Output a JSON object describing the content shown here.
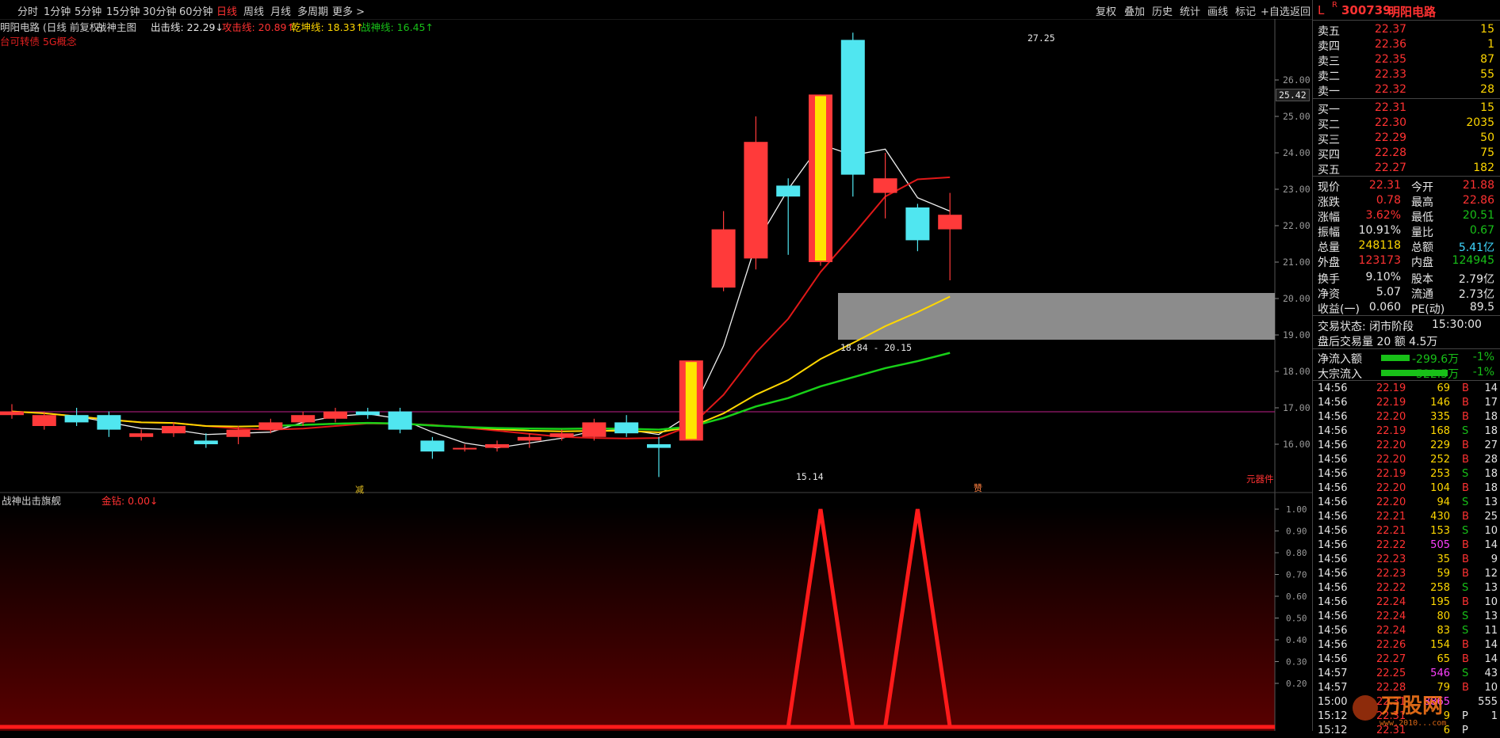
{
  "timeframes": {
    "items": [
      "分时",
      "1分钟",
      "5分钟",
      "15分钟",
      "30分钟",
      "60分钟",
      "日线",
      "周线",
      "月线",
      "多周期",
      "更多 >"
    ],
    "active": "日线"
  },
  "toolbar": {
    "items": [
      "复权",
      "叠加",
      "历史",
      "统计",
      "画线",
      "标记",
      "+自选",
      "返回"
    ]
  },
  "chart_header": {
    "stock": "明阳电路 (日线 前复权)",
    "indicator": "战神主图",
    "lines": [
      {
        "label": "出击线: 22.29↓",
        "color": "#e6e6e6"
      },
      {
        "label": "攻击线: 20.89↑",
        "color": "#ff3232"
      },
      {
        "label": "乾坤线: 18.33↑",
        "color": "#ffd700"
      },
      {
        "label": "战神线: 16.45↑",
        "color": "#18c018"
      }
    ],
    "concept": "台可转债 5G概念"
  },
  "price_axis": [
    "26.00",
    "25.00",
    "24.00",
    "23.00",
    "22.00",
    "21.00",
    "20.00",
    "19.00",
    "18.00",
    "17.00",
    "16.00"
  ],
  "price_tag": "25.42",
  "annotations": {
    "high": "27.25",
    "low": "15.14",
    "zone": "18.84 - 20.15",
    "mark_left": "减",
    "mark_right": "赞",
    "corner": "元器件"
  },
  "sub_chart": {
    "title": "战神出击旗舰",
    "value_label": "金钻: 0.00↓",
    "axis": [
      "1.00",
      "0.90",
      "0.80",
      "0.70",
      "0.60",
      "0.50",
      "0.40",
      "0.30",
      "0.20"
    ]
  },
  "chart_data": {
    "type": "candlestick",
    "candles": [
      {
        "o": 16.8,
        "c": 16.9,
        "h": 17.1,
        "l": 16.7
      },
      {
        "o": 16.5,
        "c": 16.8,
        "h": 16.9,
        "l": 16.4
      },
      {
        "o": 16.8,
        "c": 16.6,
        "h": 17.0,
        "l": 16.5
      },
      {
        "o": 16.8,
        "c": 16.4,
        "h": 16.9,
        "l": 16.2
      },
      {
        "o": 16.2,
        "c": 16.3,
        "h": 16.4,
        "l": 16.1
      },
      {
        "o": 16.3,
        "c": 16.5,
        "h": 16.6,
        "l": 16.2
      },
      {
        "o": 16.1,
        "c": 16.0,
        "h": 16.3,
        "l": 15.9
      },
      {
        "o": 16.2,
        "c": 16.4,
        "h": 16.5,
        "l": 16.0
      },
      {
        "o": 16.4,
        "c": 16.6,
        "h": 16.7,
        "l": 16.3
      },
      {
        "o": 16.6,
        "c": 16.8,
        "h": 16.9,
        "l": 16.5
      },
      {
        "o": 16.7,
        "c": 16.9,
        "h": 17.0,
        "l": 16.6
      },
      {
        "o": 16.9,
        "c": 16.8,
        "h": 17.0,
        "l": 16.7
      },
      {
        "o": 16.9,
        "c": 16.4,
        "h": 17.0,
        "l": 16.3
      },
      {
        "o": 16.1,
        "c": 15.8,
        "h": 16.2,
        "l": 15.6
      },
      {
        "o": 15.9,
        "c": 15.9,
        "h": 16.0,
        "l": 15.8
      },
      {
        "o": 15.9,
        "c": 16.0,
        "h": 16.1,
        "l": 15.8
      },
      {
        "o": 16.1,
        "c": 16.2,
        "h": 16.3,
        "l": 15.9
      },
      {
        "o": 16.2,
        "c": 16.3,
        "h": 16.4,
        "l": 16.1
      },
      {
        "o": 16.2,
        "c": 16.6,
        "h": 16.7,
        "l": 16.1
      },
      {
        "o": 16.6,
        "c": 16.3,
        "h": 16.8,
        "l": 16.2
      },
      {
        "o": 16.0,
        "c": 15.9,
        "h": 16.2,
        "l": 15.1
      },
      {
        "o": 16.1,
        "c": 18.3,
        "h": 18.3,
        "l": 16.1
      },
      {
        "o": 20.3,
        "c": 21.9,
        "h": 22.4,
        "l": 20.2
      },
      {
        "o": 21.1,
        "c": 24.3,
        "h": 25.0,
        "l": 20.8
      },
      {
        "o": 23.1,
        "c": 22.8,
        "h": 23.3,
        "l": 21.2
      },
      {
        "o": 21.0,
        "c": 25.6,
        "h": 25.6,
        "l": 20.9
      },
      {
        "o": 27.1,
        "c": 23.4,
        "h": 27.3,
        "l": 22.8
      },
      {
        "o": 22.9,
        "c": 23.3,
        "h": 24.0,
        "l": 22.2
      },
      {
        "o": 22.5,
        "c": 21.6,
        "h": 22.6,
        "l": 21.3
      },
      {
        "o": 21.9,
        "c": 22.3,
        "h": 22.9,
        "l": 20.5
      }
    ],
    "sub_values": [
      0,
      0,
      0,
      0,
      0,
      0,
      0,
      0,
      0,
      0,
      0,
      0,
      0,
      0,
      0,
      0,
      0,
      0,
      0,
      0,
      0,
      0,
      0,
      0,
      0,
      1,
      0,
      0,
      1,
      0
    ]
  },
  "quote": {
    "code": "300739",
    "name": "明阳电路",
    "prefix": "L",
    "sup": "R",
    "asks": [
      {
        "label": "卖五",
        "price": "22.37",
        "vol": "15"
      },
      {
        "label": "卖四",
        "price": "22.36",
        "vol": "1"
      },
      {
        "label": "卖三",
        "price": "22.35",
        "vol": "87"
      },
      {
        "label": "卖二",
        "price": "22.33",
        "vol": "55"
      },
      {
        "label": "卖一",
        "price": "22.32",
        "vol": "28"
      }
    ],
    "bids": [
      {
        "label": "买一",
        "price": "22.31",
        "vol": "15"
      },
      {
        "label": "买二",
        "price": "22.30",
        "vol": "2035"
      },
      {
        "label": "买三",
        "price": "22.29",
        "vol": "50"
      },
      {
        "label": "买四",
        "price": "22.28",
        "vol": "75"
      },
      {
        "label": "买五",
        "price": "22.27",
        "vol": "182"
      }
    ],
    "stats": [
      {
        "l1": "现价",
        "v1": "22.31",
        "c1": "red",
        "l2": "今开",
        "v2": "21.88",
        "c2": "red"
      },
      {
        "l1": "涨跌",
        "v1": "0.78",
        "c1": "red",
        "l2": "最高",
        "v2": "22.86",
        "c2": "red"
      },
      {
        "l1": "涨幅",
        "v1": "3.62%",
        "c1": "red",
        "l2": "最低",
        "v2": "20.51",
        "c2": "green"
      },
      {
        "l1": "振幅",
        "v1": "10.91%",
        "c1": "white",
        "l2": "量比",
        "v2": "0.67",
        "c2": "green"
      },
      {
        "l1": "总量",
        "v1": "248118",
        "c1": "yellow",
        "l2": "总额",
        "v2": "5.41亿",
        "c2": "cyan"
      },
      {
        "l1": "外盘",
        "v1": "123173",
        "c1": "red",
        "l2": "内盘",
        "v2": "124945",
        "c2": "green"
      },
      {
        "l1": "换手",
        "v1": "9.10%",
        "c1": "white",
        "l2": "股本",
        "v2": "2.79亿",
        "c2": "white"
      },
      {
        "l1": "净资",
        "v1": "5.07",
        "c1": "white",
        "l2": "流通",
        "v2": "2.73亿",
        "c2": "white"
      },
      {
        "l1": "收益(一)",
        "v1": "0.060",
        "c1": "white",
        "l2": "PE(动)",
        "v2": "89.5",
        "c2": "white"
      }
    ],
    "trade_status_label": "交易状态: 闭市阶段",
    "trade_status_time": "15:30:00",
    "after_hours": "盘后交易量 20 额 4.5万",
    "flows": [
      {
        "label": "净流入额",
        "value": "-299.6万",
        "pct": "-1%"
      },
      {
        "label": "大宗流入",
        "value": "-522.5万",
        "pct": "-1%"
      }
    ],
    "ticks": [
      {
        "t": "14:56",
        "p": "22.19",
        "v": "69",
        "s": "B",
        "n": "14",
        "vc": "yellow"
      },
      {
        "t": "14:56",
        "p": "22.19",
        "v": "146",
        "s": "B",
        "n": "17",
        "vc": "yellow"
      },
      {
        "t": "14:56",
        "p": "22.20",
        "v": "335",
        "s": "B",
        "n": "18",
        "vc": "yellow"
      },
      {
        "t": "14:56",
        "p": "22.19",
        "v": "168",
        "s": "S",
        "n": "18",
        "vc": "yellow"
      },
      {
        "t": "14:56",
        "p": "22.20",
        "v": "229",
        "s": "B",
        "n": "27",
        "vc": "yellow"
      },
      {
        "t": "14:56",
        "p": "22.20",
        "v": "252",
        "s": "B",
        "n": "28",
        "vc": "yellow"
      },
      {
        "t": "14:56",
        "p": "22.19",
        "v": "253",
        "s": "S",
        "n": "18",
        "vc": "yellow"
      },
      {
        "t": "14:56",
        "p": "22.20",
        "v": "104",
        "s": "B",
        "n": "18",
        "vc": "yellow"
      },
      {
        "t": "14:56",
        "p": "22.20",
        "v": "94",
        "s": "S",
        "n": "13",
        "vc": "yellow"
      },
      {
        "t": "14:56",
        "p": "22.21",
        "v": "430",
        "s": "B",
        "n": "25",
        "vc": "yellow"
      },
      {
        "t": "14:56",
        "p": "22.21",
        "v": "153",
        "s": "S",
        "n": "10",
        "vc": "yellow"
      },
      {
        "t": "14:56",
        "p": "22.22",
        "v": "505",
        "s": "B",
        "n": "14",
        "vc": "mag"
      },
      {
        "t": "14:56",
        "p": "22.23",
        "v": "35",
        "s": "B",
        "n": "9",
        "vc": "yellow"
      },
      {
        "t": "14:56",
        "p": "22.23",
        "v": "59",
        "s": "B",
        "n": "12",
        "vc": "yellow"
      },
      {
        "t": "14:56",
        "p": "22.22",
        "v": "258",
        "s": "S",
        "n": "13",
        "vc": "yellow"
      },
      {
        "t": "14:56",
        "p": "22.24",
        "v": "195",
        "s": "B",
        "n": "10",
        "vc": "yellow"
      },
      {
        "t": "14:56",
        "p": "22.24",
        "v": "80",
        "s": "S",
        "n": "13",
        "vc": "yellow"
      },
      {
        "t": "14:56",
        "p": "22.24",
        "v": "83",
        "s": "S",
        "n": "11",
        "vc": "yellow"
      },
      {
        "t": "14:56",
        "p": "22.26",
        "v": "154",
        "s": "B",
        "n": "14",
        "vc": "yellow"
      },
      {
        "t": "14:56",
        "p": "22.27",
        "v": "65",
        "s": "B",
        "n": "14",
        "vc": "yellow"
      },
      {
        "t": "14:57",
        "p": "22.25",
        "v": "546",
        "s": "S",
        "n": "43",
        "vc": "mag"
      },
      {
        "t": "14:57",
        "p": "22.28",
        "v": "79",
        "s": "B",
        "n": "10",
        "vc": "yellow"
      },
      {
        "t": "15:00",
        "p": "22.31",
        "v": "8865",
        "s": "",
        "n": "555",
        "vc": "mag"
      },
      {
        "t": "15:12",
        "p": "22.31",
        "v": "9",
        "s": "P",
        "n": "1",
        "vc": "yellow"
      },
      {
        "t": "15:12",
        "p": "22.31",
        "v": "6",
        "s": "P",
        "n": "",
        "vc": "yellow"
      }
    ]
  },
  "watermark": "万股网 www.2010...com"
}
